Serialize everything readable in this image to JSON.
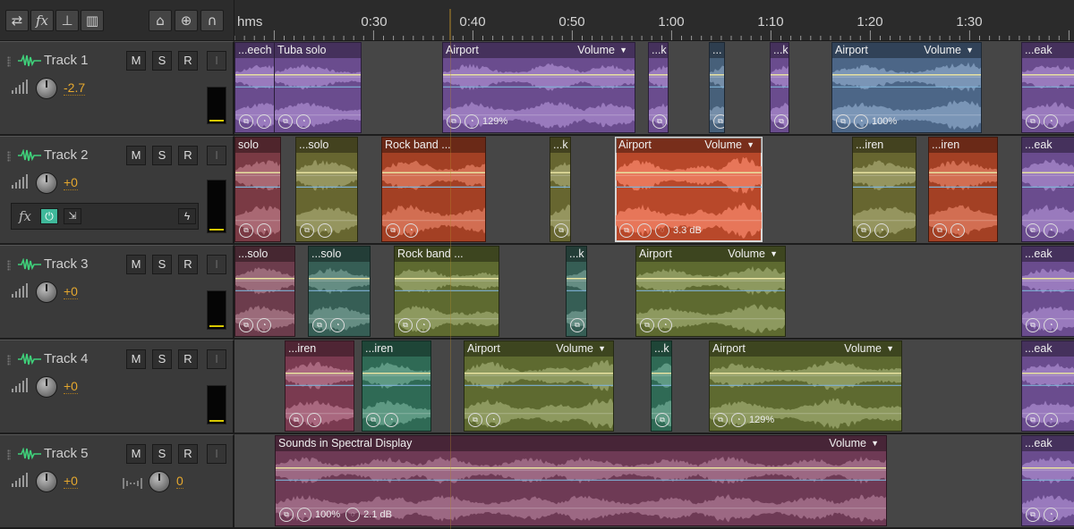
{
  "toolbar": {
    "buttons": [
      {
        "name": "switch-view-icon",
        "glyph": "⇄"
      },
      {
        "name": "fx-icon",
        "glyph": "fx"
      },
      {
        "name": "routing-icon",
        "glyph": "⊥"
      },
      {
        "name": "mixer-icon",
        "glyph": "▥"
      }
    ],
    "tools": [
      {
        "name": "metronome-icon",
        "glyph": "⌂"
      },
      {
        "name": "loop-target-icon",
        "glyph": "⊕"
      },
      {
        "name": "snap-magnet-icon",
        "glyph": "∩"
      }
    ]
  },
  "ruler": {
    "units": "hms",
    "ticks": [
      "0:30",
      "0:40",
      "0:50",
      "1:00",
      "1:10",
      "1:20",
      "1:30"
    ]
  },
  "tracks": [
    {
      "name": "Track 1",
      "mute": "M",
      "solo": "S",
      "record": "R",
      "input": "I",
      "volume": "-2.7",
      "has_fx_row": false
    },
    {
      "name": "Track 2",
      "mute": "M",
      "solo": "S",
      "record": "R",
      "input": "I",
      "volume": "+0",
      "has_fx_row": true,
      "fx_label": "fx"
    },
    {
      "name": "Track 3",
      "mute": "M",
      "solo": "S",
      "record": "R",
      "input": "I",
      "volume": "+0",
      "has_fx_row": false
    },
    {
      "name": "Track 4",
      "mute": "M",
      "solo": "S",
      "record": "R",
      "input": "I",
      "volume": "+0",
      "has_fx_row": false
    },
    {
      "name": "Track 5",
      "mute": "M",
      "solo": "S",
      "record": "R",
      "input": "I",
      "volume": "+0",
      "has_fx_row": false,
      "pan": "0"
    }
  ],
  "clips": [
    {
      "track": 0,
      "name": "...eech",
      "color": "#6a4c8e"
    },
    {
      "track": 0,
      "name": "Tuba solo",
      "color": "#6a4c8e"
    },
    {
      "track": 0,
      "name": "Airport",
      "volume_label": "Volume",
      "color": "#6a4c8e",
      "stretch": "129%"
    },
    {
      "track": 0,
      "name": "...k",
      "color": "#6a4c8e"
    },
    {
      "track": 0,
      "name": "...",
      "color": "#47607a"
    },
    {
      "track": 0,
      "name": "...k",
      "color": "#6a4c8e"
    },
    {
      "track": 0,
      "name": "Airport",
      "volume_label": "Volume",
      "color": "#4c6687",
      "stretch": "100%"
    },
    {
      "track": 0,
      "name": "...eak",
      "color": "#6a4c8e"
    },
    {
      "track": 1,
      "name": "solo",
      "color": "#7a3a44"
    },
    {
      "track": 1,
      "name": "...solo",
      "color": "#676630"
    },
    {
      "track": 1,
      "name": "Rock band ...",
      "color": "#a34024"
    },
    {
      "track": 1,
      "name": "...k",
      "color": "#676630"
    },
    {
      "track": 1,
      "name": "Airport",
      "volume_label": "Volume",
      "color": "#b8482a",
      "gain": "3.3 dB"
    },
    {
      "track": 1,
      "name": "...iren",
      "color": "#676630"
    },
    {
      "track": 1,
      "name": "...iren",
      "color": "#a34024"
    },
    {
      "track": 1,
      "name": "...eak",
      "color": "#6a4c8e"
    },
    {
      "track": 2,
      "name": "...solo",
      "color": "#6c3c4c"
    },
    {
      "track": 2,
      "name": "...solo",
      "color": "#365e55"
    },
    {
      "track": 2,
      "name": "Rock band ...",
      "color": "#5e6a30"
    },
    {
      "track": 2,
      "name": "...k",
      "color": "#365e55"
    },
    {
      "track": 2,
      "name": "Airport",
      "volume_label": "Volume",
      "color": "#5e6a30"
    },
    {
      "track": 2,
      "name": "...eak",
      "color": "#6a4c8e"
    },
    {
      "track": 3,
      "name": "...iren",
      "color": "#7a3a50"
    },
    {
      "track": 3,
      "name": "...iren",
      "color": "#2f6a55"
    },
    {
      "track": 3,
      "name": "Airport",
      "volume_label": "Volume",
      "color": "#5e6a30"
    },
    {
      "track": 3,
      "name": "...k",
      "color": "#2f6a55"
    },
    {
      "track": 3,
      "name": "Airport",
      "volume_label": "Volume",
      "color": "#5e6a30",
      "stretch": "129%"
    },
    {
      "track": 3,
      "name": "...eak",
      "color": "#6a4c8e"
    },
    {
      "track": 4,
      "name": "Sounds in Spectral Display",
      "volume_label": "Volume",
      "color": "#6e3a55",
      "stretch": "100%",
      "gain": "2.1 dB"
    },
    {
      "track": 4,
      "name": "...eak",
      "color": "#6a4c8e"
    }
  ],
  "colors": {
    "volume_value": "#e6a82e",
    "meter_peak": "#d8c800",
    "fx_power": "#3fb89a"
  }
}
